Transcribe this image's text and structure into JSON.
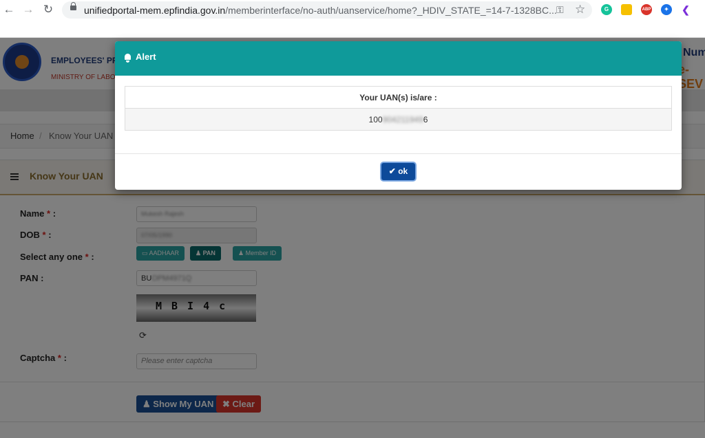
{
  "browser": {
    "url_host": "unifiedportal-mem.epfindia.gov.in",
    "url_path": "/memberinterface/no-auth/uanservice/home?_HDIV_STATE_=14-7-1328BC..."
  },
  "header": {
    "org_name": "EMPLOYEES' PR",
    "ministry": "MINISTRY OF LABO",
    "right_top": "Num",
    "right_bottom": "e-SEV"
  },
  "breadcrumb": {
    "home": "Home",
    "separator": "/",
    "current": "Know Your UAN"
  },
  "panel": {
    "title": "Know Your UAN"
  },
  "form": {
    "name_label": "Name",
    "name_value": "Mukesh Rajesh",
    "dob_label": "DOB",
    "dob_value": "07/05/1990",
    "select_label": "Select any one",
    "options": {
      "aadhaar": "AADHAAR",
      "pan": "PAN",
      "member_id": "Member ID"
    },
    "pan_label": "PAN :",
    "pan_value_visible": "BU",
    "pan_value_hidden": "OPM4971Q",
    "captcha_text": "MBI4c",
    "captcha_label": "Captcha",
    "captcha_placeholder": "Please enter captcha",
    "required_mark": "*",
    "colon": " :"
  },
  "buttons": {
    "show_uan": "Show My UAN",
    "clear": "Clear"
  },
  "modal": {
    "title": "Alert",
    "table_header": "Your UAN(s) is/are :",
    "uan_prefix": "100",
    "uan_hidden": "904211949",
    "uan_suffix": "6",
    "ok_label": "ok"
  },
  "colors": {
    "modal_header": "#0f9a9a",
    "ok_button": "#0d4a9a",
    "show_uan_button": "#1a4f94",
    "clear_button": "#d9342b",
    "selected_option": "#0b6b6b",
    "unselected_option": "#2ba3a3"
  }
}
